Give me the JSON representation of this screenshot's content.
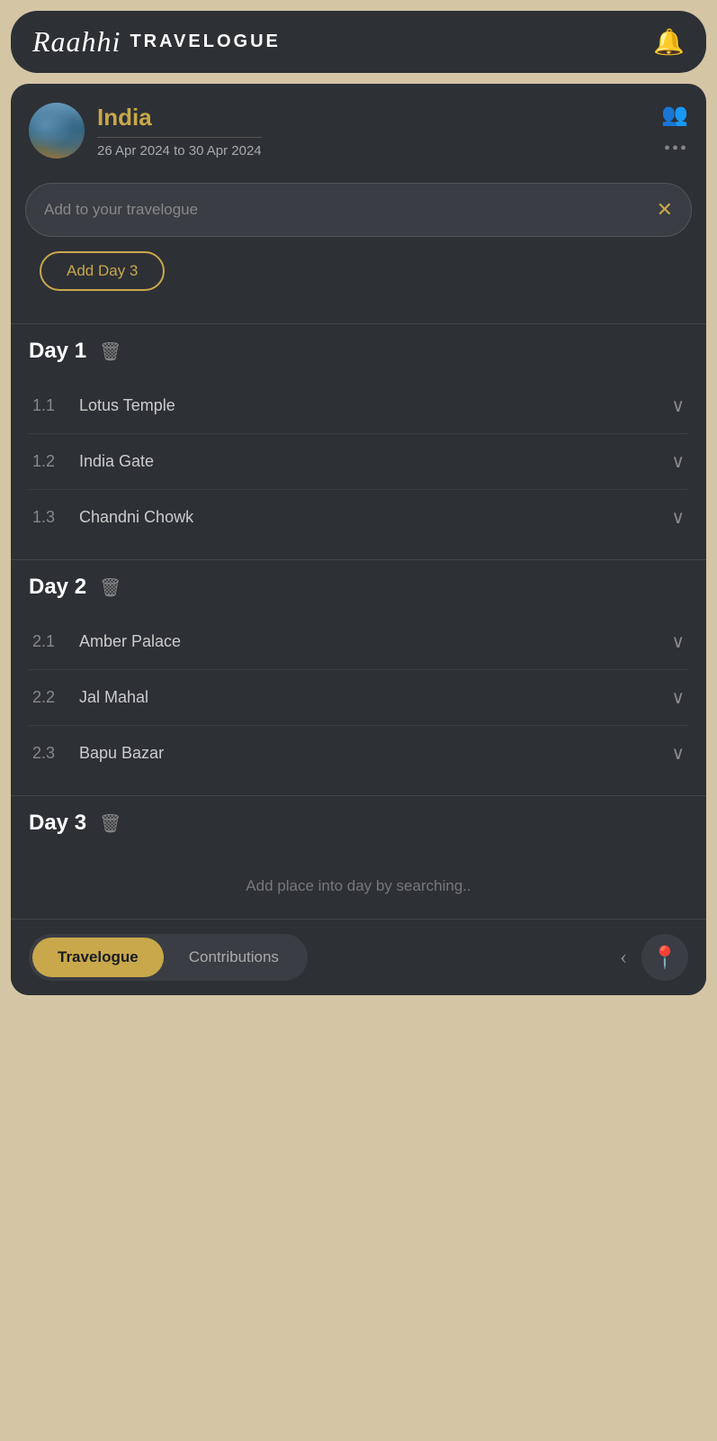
{
  "header": {
    "logo_script": "Raahhi",
    "logo_text": "TRAVELOGUE",
    "bell_label": "🔔"
  },
  "trip": {
    "name": "India",
    "dates": "26 Apr 2024 to 30 Apr 2024",
    "people_icon": "👥",
    "more_icon": "•••"
  },
  "search": {
    "placeholder": "Add to your travelogue",
    "close_label": "✕"
  },
  "add_day_button": "Add Day 3",
  "days": [
    {
      "label": "Day 1",
      "places": [
        {
          "num": "1.1",
          "name": "Lotus Temple"
        },
        {
          "num": "1.2",
          "name": "India Gate"
        },
        {
          "num": "1.3",
          "name": "Chandni Chowk"
        }
      ]
    },
    {
      "label": "Day 2",
      "places": [
        {
          "num": "2.1",
          "name": "Amber Palace"
        },
        {
          "num": "2.2",
          "name": "Jal Mahal"
        },
        {
          "num": "2.3",
          "name": "Bapu Bazar"
        }
      ]
    },
    {
      "label": "Day 3",
      "places": [],
      "empty_message": "Add place into day by searching.."
    }
  ],
  "bottom_nav": {
    "tab_travelogue": "Travelogue",
    "tab_contributions": "Contributions",
    "back_arrow": "‹",
    "map_icon": "📍"
  }
}
